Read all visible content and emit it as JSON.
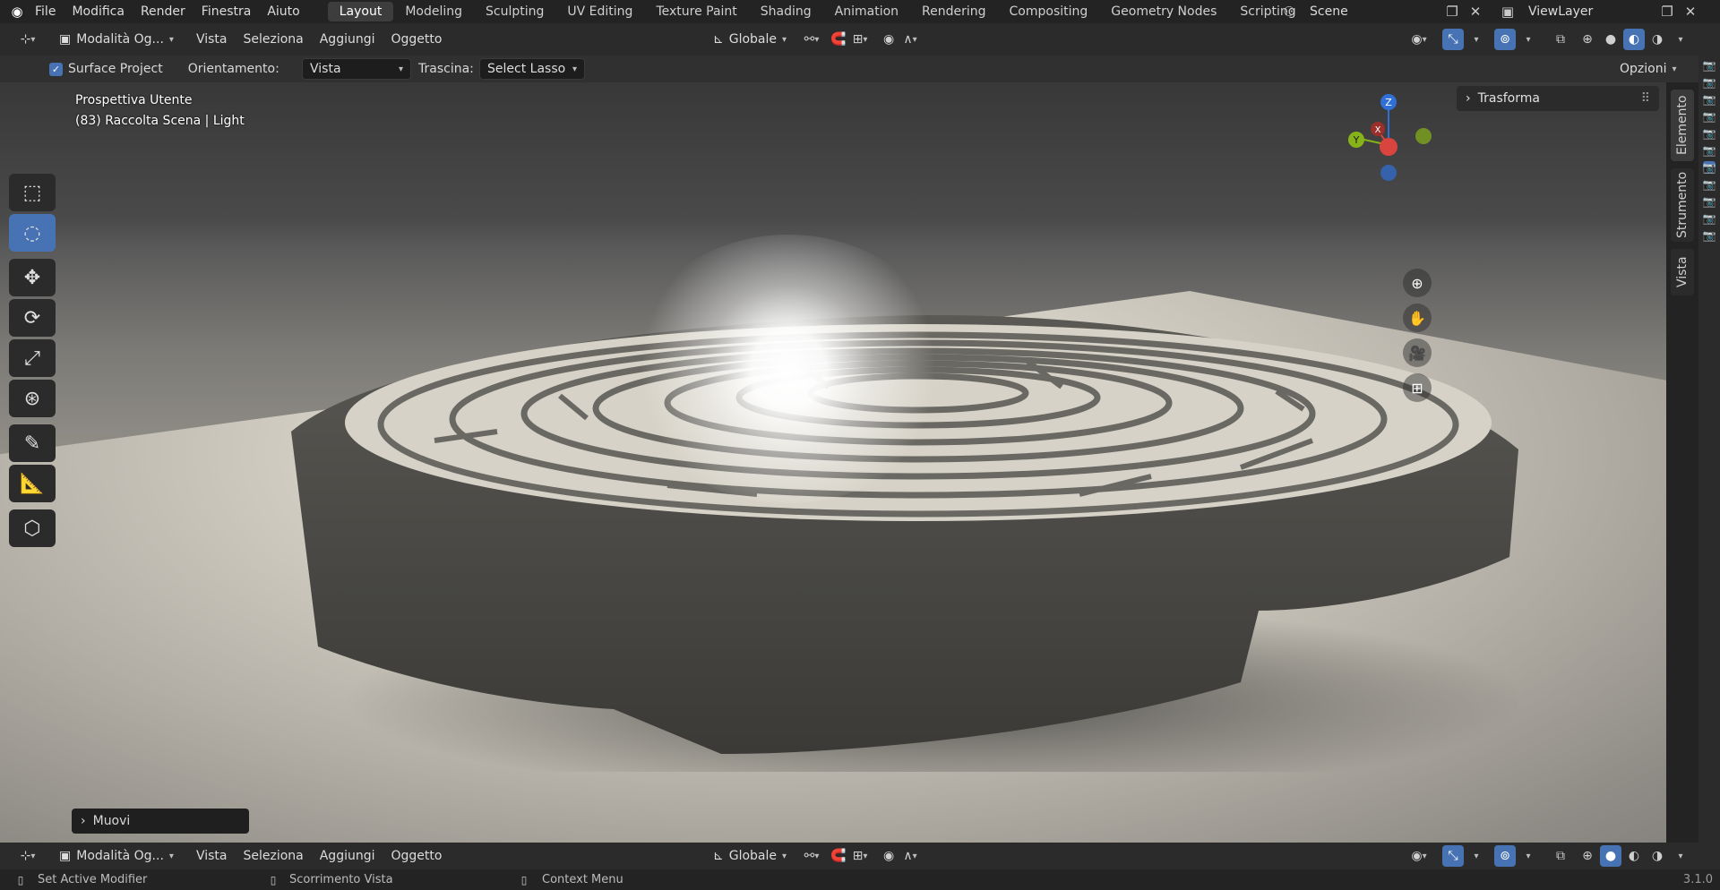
{
  "topbar": {
    "menus": [
      "File",
      "Modifica",
      "Render",
      "Finestra",
      "Aiuto"
    ],
    "workspaces": [
      "Layout",
      "Modeling",
      "Sculpting",
      "UV Editing",
      "Texture Paint",
      "Shading",
      "Animation",
      "Rendering",
      "Compositing",
      "Geometry Nodes",
      "Scripting"
    ],
    "active_workspace": "Layout",
    "add_tab": "+",
    "scene": "Scene",
    "view_layer": "ViewLayer"
  },
  "header": {
    "mode": "Modalità Og...",
    "menus": [
      "Vista",
      "Seleziona",
      "Aggiungi",
      "Oggetto"
    ],
    "transform_orientation": "Globale"
  },
  "tool_settings": {
    "surface_project_label": "Surface Project",
    "surface_project_checked": true,
    "orientation_label": "Orientamento:",
    "orientation_value": "Vista",
    "drag_label": "Trascina:",
    "drag_value": "Select Lasso",
    "options": "Opzioni"
  },
  "viewport": {
    "view_name": "Prospettiva Utente",
    "collection_info": "(83) Raccolta Scena | Light",
    "gizmo_axes": {
      "z": "Z",
      "x": "X",
      "y": "Y"
    },
    "gizmo_colors": {
      "z": "#2f6fd6",
      "x": "#d9443f",
      "y": "#86b418"
    }
  },
  "sidebar": {
    "panel": "Trasforma",
    "tabs": [
      "Elemento",
      "Strumento",
      "Vista"
    ]
  },
  "last_operator": "Muovi",
  "bottom_header": {
    "mode": "Modalità Og...",
    "menus": [
      "Vista",
      "Seleziona",
      "Aggiungi",
      "Oggetto"
    ],
    "transform_orientation": "Globale"
  },
  "statusbar": {
    "left": "Set Active Modifier",
    "middle": "Scorrimento Vista",
    "right": "Context Menu",
    "version": "3.1.0"
  },
  "accent_color": "#4772b3"
}
